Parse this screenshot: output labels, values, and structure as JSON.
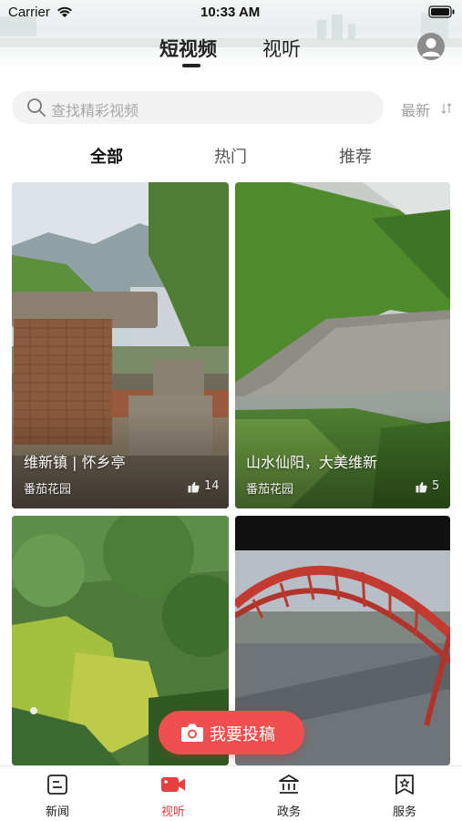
{
  "status_bar": {
    "carrier": "Carrier",
    "time": "10:33 AM"
  },
  "header": {
    "tabs": [
      {
        "label": "短视频",
        "active": true
      },
      {
        "label": "视听",
        "active": false
      }
    ]
  },
  "search": {
    "placeholder": "查找精彩视频",
    "sort_label": "最新"
  },
  "filters": [
    {
      "label": "全部",
      "active": true
    },
    {
      "label": "热门",
      "active": false
    },
    {
      "label": "推荐",
      "active": false
    }
  ],
  "cards": [
    {
      "title": "维新镇 | 怀乡亭",
      "author": "番茄花园",
      "likes": "14"
    },
    {
      "title": "山水仙阳，大美维新",
      "author": "番茄花园",
      "likes": "5"
    },
    {
      "title": "",
      "author": "",
      "likes": ""
    },
    {
      "title": "",
      "author": "",
      "likes": ""
    }
  ],
  "fab": {
    "label": "我要投稿"
  },
  "tab_bar": [
    {
      "label": "新闻",
      "icon": "news-icon",
      "active": false
    },
    {
      "label": "视听",
      "icon": "video-camera-icon",
      "active": true
    },
    {
      "label": "政务",
      "icon": "government-building-icon",
      "active": false
    },
    {
      "label": "服务",
      "icon": "service-bookmark-icon",
      "active": false
    }
  ],
  "colors": {
    "accent": "#f04f4f",
    "active_tab": "#e83e3e",
    "text": "#222222"
  }
}
